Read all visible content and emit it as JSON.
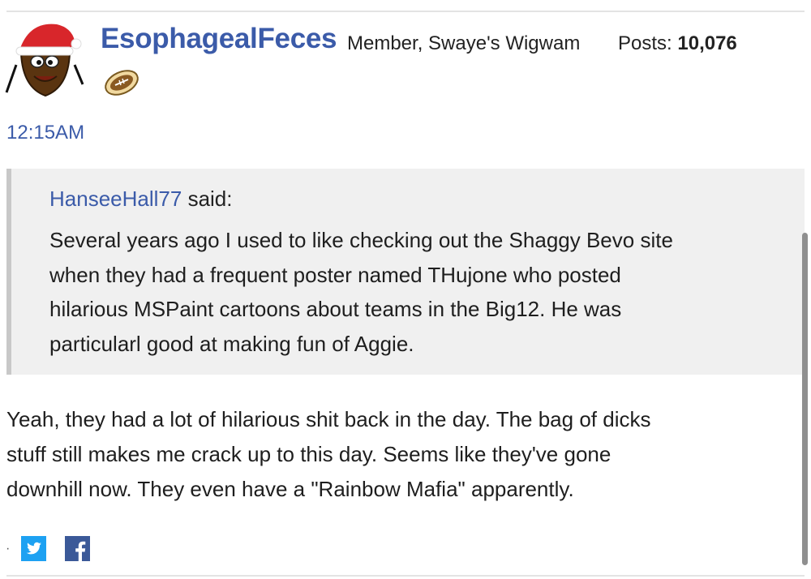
{
  "post": {
    "username": "EsophagealFeces",
    "rank": "Member, Swaye's Wigwam",
    "posts_label": "Posts:",
    "posts_count": "10,076",
    "timestamp": "12:15AM",
    "avatar_icon": "mr-hankey-santa-hat-icon",
    "badge_icon": "football-icon"
  },
  "quote": {
    "author": "HanseeHall77",
    "said": "said:",
    "lines": [
      "Several years ago I used to like checking out the Shaggy Bevo site",
      "when they had a frequent poster named THujone who posted",
      "hilarious MSPaint cartoons about teams in the Big12. He was",
      "particularl good at making fun of Aggie."
    ]
  },
  "reply": {
    "lines": [
      "Yeah, they had a lot of hilarious shit back in the day. The bag of dicks",
      "stuff still makes me crack up to this day. Seems like they've gone",
      "downhill now. They even have a \"Rainbow Mafia\" apparently."
    ]
  },
  "share": {
    "separator": "·",
    "twitter_icon": "twitter-icon",
    "facebook_icon": "facebook-icon"
  },
  "colors": {
    "link": "#3b5ba9",
    "quote_bg": "#f0f0f0",
    "twitter": "#1da1f2",
    "facebook": "#3b5998"
  }
}
